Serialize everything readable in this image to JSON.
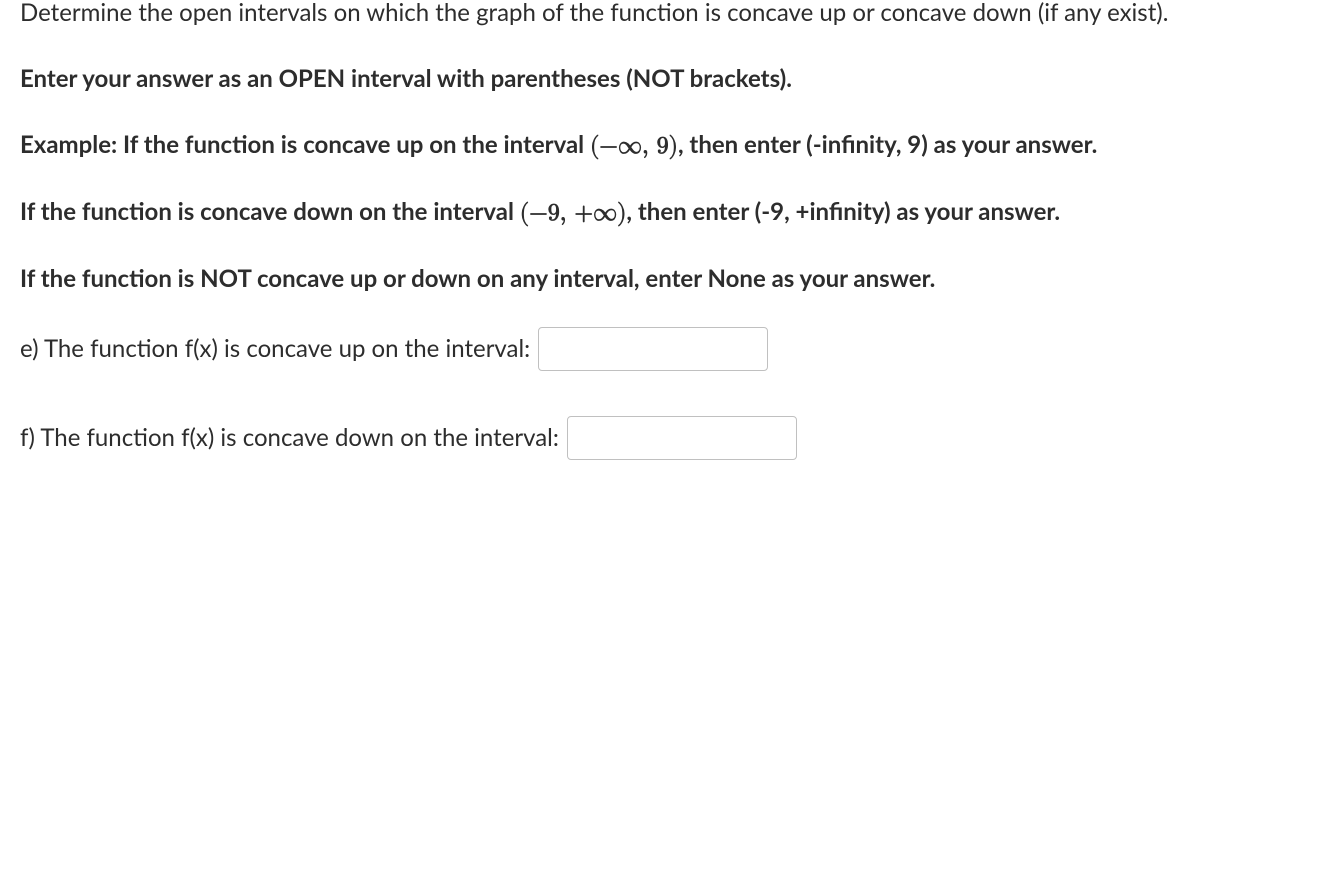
{
  "paragraphs": {
    "intro1": "Determine the open intervals on which the graph of the function is concave up or concave down (if any exist).",
    "intro2": "Enter your answer as an OPEN interval with parentheses (NOT brackets).",
    "example1_pre": "Example: If the function is concave up on the interval ",
    "example1_math": "(−∞, 9)",
    "example1_post": ", then enter (-infinity, 9) as your answer.",
    "example2_pre": "If the function is concave down on the interval ",
    "example2_math": "(−9, +∞)",
    "example2_post": ", then enter (-9, +infinity) as your answer.",
    "none_rule": "If the function is NOT concave up or down on any interval, enter None as your answer."
  },
  "questions": {
    "e_label": "e) The function f(x) is concave up on the interval: ",
    "f_label": "f) The function f(x) is concave down on the interval: "
  },
  "inputs": {
    "e_value": "",
    "f_value": ""
  }
}
